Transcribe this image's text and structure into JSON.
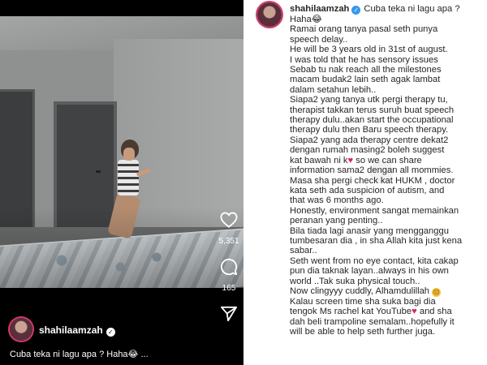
{
  "reel": {
    "like_count": "5,351",
    "comment_count": "165",
    "username": "shahilaamzah",
    "caption_preview": "Cuba teka ni lagu apa ? Haha😂 ..."
  },
  "icons": {
    "like": "heart-icon",
    "comment": "comment-icon",
    "share": "send-icon",
    "verified": "verified-badge-icon"
  },
  "colors": {
    "avatar_ring": "#d43a6b",
    "verified_blue": "#3897f0",
    "heart_red": "#e0245e"
  },
  "post": {
    "username": "shahilaamzah",
    "lines": [
      "Cuba teka ni lagu apa ?",
      "Haha😂",
      "Ramai orang tanya pasal seth punya",
      "speech delay..",
      "He will be 3 years old in 31st of august.",
      "I was told that he has sensory issues",
      "Sebab tu nak reach all the milestones",
      "macam budak2 lain seth agak lambat",
      "dalam setahun lebih..",
      "Siapa2 yang tanya utk pergi therapy tu,",
      "therapist takkan terus suruh buat speech",
      "therapy dulu..akan start the occupational",
      "therapy dulu then Baru speech therapy.",
      "Siapa2 yang ada therapy centre dekat2",
      "dengan rumah masing2 boleh suggest",
      "kat bawah ni k",
      "information sama2 dengan all mommies.",
      "Masa sha pergi check kat HUKM , doctor",
      "kata seth ada suspicion of autism, and",
      "that was 6 months ago.",
      "Honestly, environment sangat memainkan",
      "peranan yang penting..",
      "Bila tiada lagi anasir yang mengganggu",
      "tumbesaran dia , in sha Allah kita just kena",
      "sabar..",
      "Seth went from no eye contact, kita cakap",
      "pun dia taknak layan..always in his own",
      "world ..Tak suka physical touch..",
      "Now clingyyy cuddly, Alhamdulillah",
      "Kalau screen time sha suka bagi dia",
      "tengok Ms rachel kat YouTube",
      "and sha",
      "dah beli trampoline semalam..hopefully it",
      "will be able to help seth further juga."
    ],
    "line16_tail": "so we can share"
  }
}
